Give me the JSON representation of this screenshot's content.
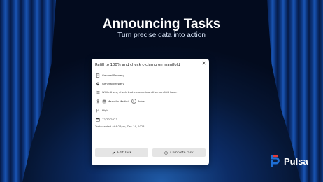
{
  "hero": {
    "title": "Announcing Tasks",
    "subtitle": "Turn precise data into action"
  },
  "task": {
    "title": "Refill to 100% and check c-clamp on manifold",
    "customer": "General Brewery",
    "location": "General Brewery",
    "description": "While there, check that c-clamp is on the manifold hose.",
    "assignees": [
      {
        "initials": "MM",
        "name": "Marcello Medini"
      },
      {
        "initials": "P",
        "name": "Pulsa"
      }
    ],
    "priority": "High",
    "due_date": "12/22/2023",
    "created": "Task created at 4:24pm, Dec 14, 2023",
    "edit_label": "Edit Task",
    "complete_label": "Complete task"
  },
  "brand": {
    "name": "Pulsa",
    "accent": "#1e6fd6",
    "accent_red": "#e23b3b"
  },
  "icons": [
    "close-icon",
    "building-icon",
    "location-pin-icon",
    "list-icon",
    "person-icon",
    "flag-icon",
    "calendar-icon",
    "pencil-icon",
    "check-circle-icon"
  ]
}
